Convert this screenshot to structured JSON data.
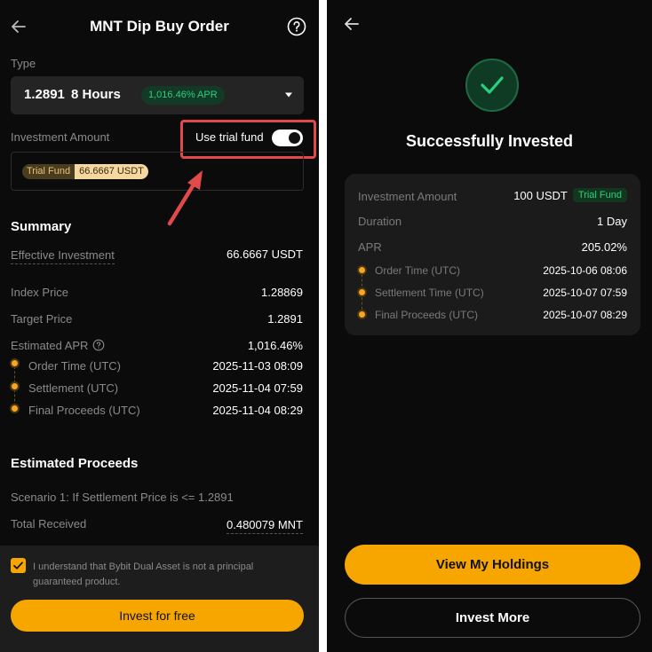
{
  "left": {
    "title": "MNT Dip Buy Order",
    "type_label": "Type",
    "type": {
      "price": "1.2891",
      "duration": "8 Hours",
      "apr": "1,016.46% APR"
    },
    "investment_amount_label": "Investment Amount",
    "use_trial_fund_label": "Use trial fund",
    "trial_fund_on": true,
    "trial_chip": {
      "label": "Trial Fund",
      "amount": "66.6667 USDT"
    },
    "summary_title": "Summary",
    "summary": {
      "effective_investment_label": "Effective Investment",
      "effective_investment_value": "66.6667 USDT",
      "index_price_label": "Index Price",
      "index_price_value": "1.28869",
      "target_price_label": "Target Price",
      "target_price_value": "1.2891",
      "estimated_apr_label": "Estimated APR",
      "estimated_apr_value": "1,016.46%",
      "order_time_label": "Order Time (UTC)",
      "order_time_value": "2025-11-03 08:09",
      "settlement_label": "Settlement (UTC)",
      "settlement_value": "2025-11-04 07:59",
      "final_proceeds_label": "Final Proceeds (UTC)",
      "final_proceeds_value": "2025-11-04 08:29"
    },
    "estimated_proceeds_title": "Estimated Proceeds",
    "scenario_text": "Scenario 1: If Settlement Price is <= 1.2891",
    "total_received_label": "Total Received",
    "total_received_value": "0.480079 MNT",
    "disclaimer": "I understand that Bybit Dual Asset is not a principal guaranteed product.",
    "disclaimer_checked": true,
    "invest_button": "Invest for free"
  },
  "right": {
    "success_title": "Successfully Invested",
    "card": {
      "investment_amount_label": "Investment Amount",
      "investment_amount_value": "100 USDT",
      "trial_fund_badge": "Trial Fund",
      "duration_label": "Duration",
      "duration_value": "1 Day",
      "apr_label": "APR",
      "apr_value": "205.02%",
      "order_time_label": "Order Time (UTC)",
      "order_time_value": "2025-10-06 08:06",
      "settlement_time_label": "Settlement Time (UTC)",
      "settlement_time_value": "2025-10-07 07:59",
      "final_proceeds_label": "Final Proceeds (UTC)",
      "final_proceeds_value": "2025-10-07 08:29"
    },
    "view_holdings_button": "View My Holdings",
    "invest_more_button": "Invest More"
  },
  "colors": {
    "accent": "#f7a600",
    "green": "#2ad07f",
    "highlight_red": "#e24a4a",
    "background": "#0b0b0b"
  },
  "icons": [
    "back-arrow-icon",
    "help-icon",
    "chevron-down-icon",
    "info-icon",
    "checkbox-checked-icon",
    "checkmark-icon"
  ]
}
